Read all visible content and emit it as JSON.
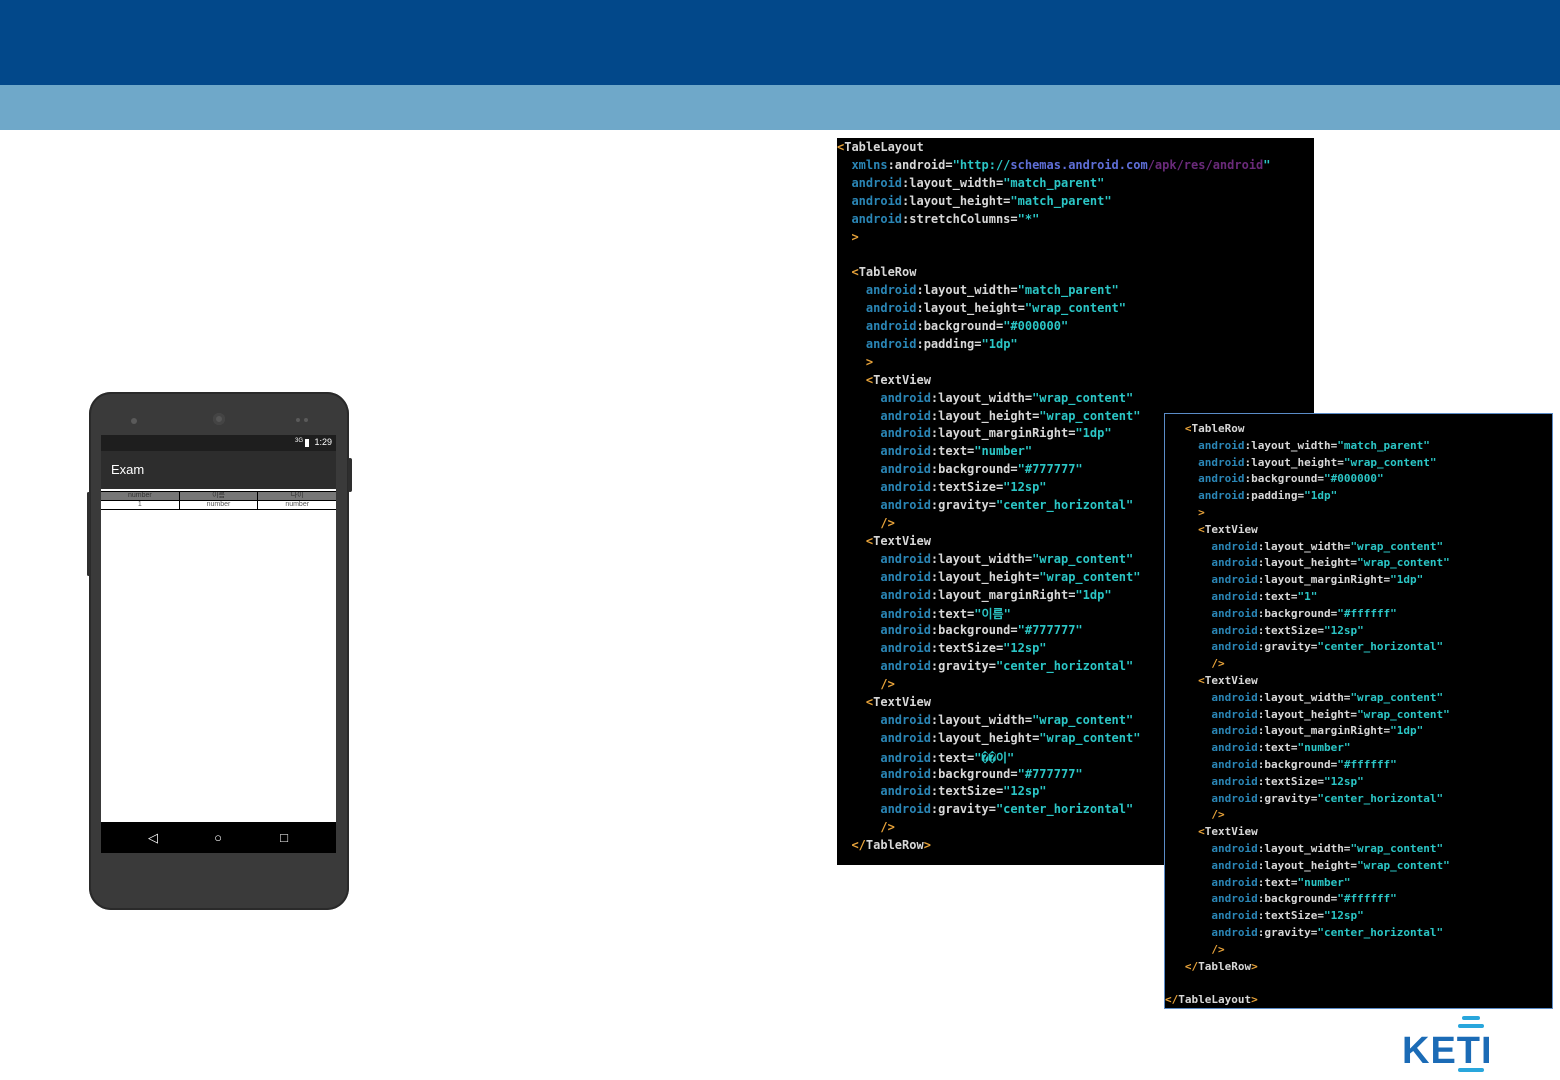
{
  "brand": {
    "logo_text": "KETI"
  },
  "phone": {
    "status": {
      "signal": "3G",
      "time": "1:29"
    },
    "app_title": "Exam",
    "table": {
      "header": [
        "number",
        "이름",
        "나이"
      ],
      "row": [
        "1",
        "number",
        "number"
      ]
    },
    "nav": {
      "back": "◁",
      "home": "○",
      "recents": "□"
    }
  },
  "code_left": [
    [
      [
        "tag",
        "<"
      ],
      [
        "tagname",
        "TableLayout"
      ]
    ],
    [
      [
        "ns",
        "  xmlns"
      ],
      [
        "attr",
        ":android="
      ],
      [
        "val",
        "\"http://"
      ],
      [
        "valb",
        "schemas.android.com"
      ],
      [
        "valp",
        "/apk/res/android"
      ],
      [
        "val",
        "\""
      ]
    ],
    [
      [
        "ns",
        "  android"
      ],
      [
        "attr",
        ":layout_width="
      ],
      [
        "val",
        "\"match_parent\""
      ]
    ],
    [
      [
        "ns",
        "  android"
      ],
      [
        "attr",
        ":layout_height="
      ],
      [
        "val",
        "\"match_parent\""
      ]
    ],
    [
      [
        "ns",
        "  android"
      ],
      [
        "attr",
        ":stretchColumns="
      ],
      [
        "val",
        "\"*\""
      ]
    ],
    [
      [
        "tag",
        "  >"
      ]
    ],
    [],
    [
      [
        "tag",
        "  <"
      ],
      [
        "tagname",
        "TableRow"
      ]
    ],
    [
      [
        "ns",
        "    android"
      ],
      [
        "attr",
        ":layout_width="
      ],
      [
        "val",
        "\"match_parent\""
      ]
    ],
    [
      [
        "ns",
        "    android"
      ],
      [
        "attr",
        ":layout_height="
      ],
      [
        "val",
        "\"wrap_content\""
      ]
    ],
    [
      [
        "ns",
        "    android"
      ],
      [
        "attr",
        ":background="
      ],
      [
        "val",
        "\"#000000\""
      ]
    ],
    [
      [
        "ns",
        "    android"
      ],
      [
        "attr",
        ":padding="
      ],
      [
        "val",
        "\"1dp\""
      ]
    ],
    [
      [
        "tag",
        "    >"
      ]
    ],
    [
      [
        "tag",
        "    <"
      ],
      [
        "tagname",
        "TextView"
      ]
    ],
    [
      [
        "ns",
        "      android"
      ],
      [
        "attr",
        ":layout_width="
      ],
      [
        "val",
        "\"wrap_content\""
      ]
    ],
    [
      [
        "ns",
        "      android"
      ],
      [
        "attr",
        ":layout_height="
      ],
      [
        "val",
        "\"wrap_content\""
      ]
    ],
    [
      [
        "ns",
        "      android"
      ],
      [
        "attr",
        ":layout_marginRight="
      ],
      [
        "val",
        "\"1dp\""
      ]
    ],
    [
      [
        "ns",
        "      android"
      ],
      [
        "attr",
        ":text="
      ],
      [
        "val",
        "\"number\""
      ]
    ],
    [
      [
        "ns",
        "      android"
      ],
      [
        "attr",
        ":background="
      ],
      [
        "val",
        "\"#777777\""
      ]
    ],
    [
      [
        "ns",
        "      android"
      ],
      [
        "attr",
        ":textSize="
      ],
      [
        "val",
        "\"12sp\""
      ]
    ],
    [
      [
        "ns",
        "      android"
      ],
      [
        "attr",
        ":gravity="
      ],
      [
        "val",
        "\"center_horizontal\""
      ]
    ],
    [
      [
        "tag",
        "      />"
      ]
    ],
    [
      [
        "tag",
        "    <"
      ],
      [
        "tagname",
        "TextView"
      ]
    ],
    [
      [
        "ns",
        "      android"
      ],
      [
        "attr",
        ":layout_width="
      ],
      [
        "val",
        "\"wrap_content\""
      ]
    ],
    [
      [
        "ns",
        "      android"
      ],
      [
        "attr",
        ":layout_height="
      ],
      [
        "val",
        "\"wrap_content\""
      ]
    ],
    [
      [
        "ns",
        "      android"
      ],
      [
        "attr",
        ":layout_marginRight="
      ],
      [
        "val",
        "\"1dp\""
      ]
    ],
    [
      [
        "ns",
        "      android"
      ],
      [
        "attr",
        ":text="
      ],
      [
        "val",
        "\"이름\""
      ]
    ],
    [
      [
        "ns",
        "      android"
      ],
      [
        "attr",
        ":background="
      ],
      [
        "val",
        "\"#777777\""
      ]
    ],
    [
      [
        "ns",
        "      android"
      ],
      [
        "attr",
        ":textSize="
      ],
      [
        "val",
        "\"12sp\""
      ]
    ],
    [
      [
        "ns",
        "      android"
      ],
      [
        "attr",
        ":gravity="
      ],
      [
        "val",
        "\"center_horizontal\""
      ]
    ],
    [
      [
        "tag",
        "      />"
      ]
    ],
    [
      [
        "tag",
        "    <"
      ],
      [
        "tagname",
        "TextView"
      ]
    ],
    [
      [
        "ns",
        "      android"
      ],
      [
        "attr",
        ":layout_width="
      ],
      [
        "val",
        "\"wrap_content\""
      ]
    ],
    [
      [
        "ns",
        "      android"
      ],
      [
        "attr",
        ":layout_height="
      ],
      [
        "val",
        "\"wrap_content\""
      ]
    ],
    [
      [
        "ns",
        "      android"
      ],
      [
        "attr",
        ":text="
      ],
      [
        "val",
        "\"��이\""
      ]
    ],
    [
      [
        "ns",
        "      android"
      ],
      [
        "attr",
        ":background="
      ],
      [
        "val",
        "\"#777777\""
      ]
    ],
    [
      [
        "ns",
        "      android"
      ],
      [
        "attr",
        ":textSize="
      ],
      [
        "val",
        "\"12sp\""
      ]
    ],
    [
      [
        "ns",
        "      android"
      ],
      [
        "attr",
        ":gravity="
      ],
      [
        "val",
        "\"center_horizontal\""
      ]
    ],
    [
      [
        "tag",
        "      />"
      ]
    ],
    [
      [
        "tag",
        "  </"
      ],
      [
        "tagname",
        "TableRow"
      ],
      [
        "tag",
        ">"
      ]
    ]
  ],
  "code_right": [
    [
      [
        "tag",
        "   <"
      ],
      [
        "tagname",
        "TableRow"
      ]
    ],
    [
      [
        "ns",
        "     android"
      ],
      [
        "attr",
        ":layout_width="
      ],
      [
        "val",
        "\"match_parent\""
      ]
    ],
    [
      [
        "ns",
        "     android"
      ],
      [
        "attr",
        ":layout_height="
      ],
      [
        "val",
        "\"wrap_content\""
      ]
    ],
    [
      [
        "ns",
        "     android"
      ],
      [
        "attr",
        ":background="
      ],
      [
        "val",
        "\"#000000\""
      ]
    ],
    [
      [
        "ns",
        "     android"
      ],
      [
        "attr",
        ":padding="
      ],
      [
        "val",
        "\"1dp\""
      ]
    ],
    [
      [
        "tag",
        "     >"
      ]
    ],
    [
      [
        "tag",
        "     <"
      ],
      [
        "tagname",
        "TextView"
      ]
    ],
    [
      [
        "ns",
        "       android"
      ],
      [
        "attr",
        ":layout_width="
      ],
      [
        "val",
        "\"wrap_content\""
      ]
    ],
    [
      [
        "ns",
        "       android"
      ],
      [
        "attr",
        ":layout_height="
      ],
      [
        "val",
        "\"wrap_content\""
      ]
    ],
    [
      [
        "ns",
        "       android"
      ],
      [
        "attr",
        ":layout_marginRight="
      ],
      [
        "val",
        "\"1dp\""
      ]
    ],
    [
      [
        "ns",
        "       android"
      ],
      [
        "attr",
        ":text="
      ],
      [
        "val",
        "\"1\""
      ]
    ],
    [
      [
        "ns",
        "       android"
      ],
      [
        "attr",
        ":background="
      ],
      [
        "val",
        "\"#ffffff\""
      ]
    ],
    [
      [
        "ns",
        "       android"
      ],
      [
        "attr",
        ":textSize="
      ],
      [
        "val",
        "\"12sp\""
      ]
    ],
    [
      [
        "ns",
        "       android"
      ],
      [
        "attr",
        ":gravity="
      ],
      [
        "val",
        "\"center_horizontal\""
      ]
    ],
    [
      [
        "tag",
        "       />"
      ]
    ],
    [
      [
        "tag",
        "     <"
      ],
      [
        "tagname",
        "TextView"
      ]
    ],
    [
      [
        "ns",
        "       android"
      ],
      [
        "attr",
        ":layout_width="
      ],
      [
        "val",
        "\"wrap_content\""
      ]
    ],
    [
      [
        "ns",
        "       android"
      ],
      [
        "attr",
        ":layout_height="
      ],
      [
        "val",
        "\"wrap_content\""
      ]
    ],
    [
      [
        "ns",
        "       android"
      ],
      [
        "attr",
        ":layout_marginRight="
      ],
      [
        "val",
        "\"1dp\""
      ]
    ],
    [
      [
        "ns",
        "       android"
      ],
      [
        "attr",
        ":text="
      ],
      [
        "val",
        "\"number\""
      ]
    ],
    [
      [
        "ns",
        "       android"
      ],
      [
        "attr",
        ":background="
      ],
      [
        "val",
        "\"#ffffff\""
      ]
    ],
    [
      [
        "ns",
        "       android"
      ],
      [
        "attr",
        ":textSize="
      ],
      [
        "val",
        "\"12sp\""
      ]
    ],
    [
      [
        "ns",
        "       android"
      ],
      [
        "attr",
        ":gravity="
      ],
      [
        "val",
        "\"center_horizontal\""
      ]
    ],
    [
      [
        "tag",
        "       />"
      ]
    ],
    [
      [
        "tag",
        "     <"
      ],
      [
        "tagname",
        "TextView"
      ]
    ],
    [
      [
        "ns",
        "       android"
      ],
      [
        "attr",
        ":layout_width="
      ],
      [
        "val",
        "\"wrap_content\""
      ]
    ],
    [
      [
        "ns",
        "       android"
      ],
      [
        "attr",
        ":layout_height="
      ],
      [
        "val",
        "\"wrap_content\""
      ]
    ],
    [
      [
        "ns",
        "       android"
      ],
      [
        "attr",
        ":text="
      ],
      [
        "val",
        "\"number\""
      ]
    ],
    [
      [
        "ns",
        "       android"
      ],
      [
        "attr",
        ":background="
      ],
      [
        "val",
        "\"#ffffff\""
      ]
    ],
    [
      [
        "ns",
        "       android"
      ],
      [
        "attr",
        ":textSize="
      ],
      [
        "val",
        "\"12sp\""
      ]
    ],
    [
      [
        "ns",
        "       android"
      ],
      [
        "attr",
        ":gravity="
      ],
      [
        "val",
        "\"center_horizontal\""
      ]
    ],
    [
      [
        "tag",
        "       />"
      ]
    ],
    [
      [
        "tag",
        "   </"
      ],
      [
        "tagname",
        "TableRow"
      ],
      [
        "tag",
        ">"
      ]
    ],
    [],
    [
      [
        "tag",
        "</"
      ],
      [
        "tagname",
        "TableLayout"
      ],
      [
        "tag",
        ">"
      ]
    ]
  ]
}
